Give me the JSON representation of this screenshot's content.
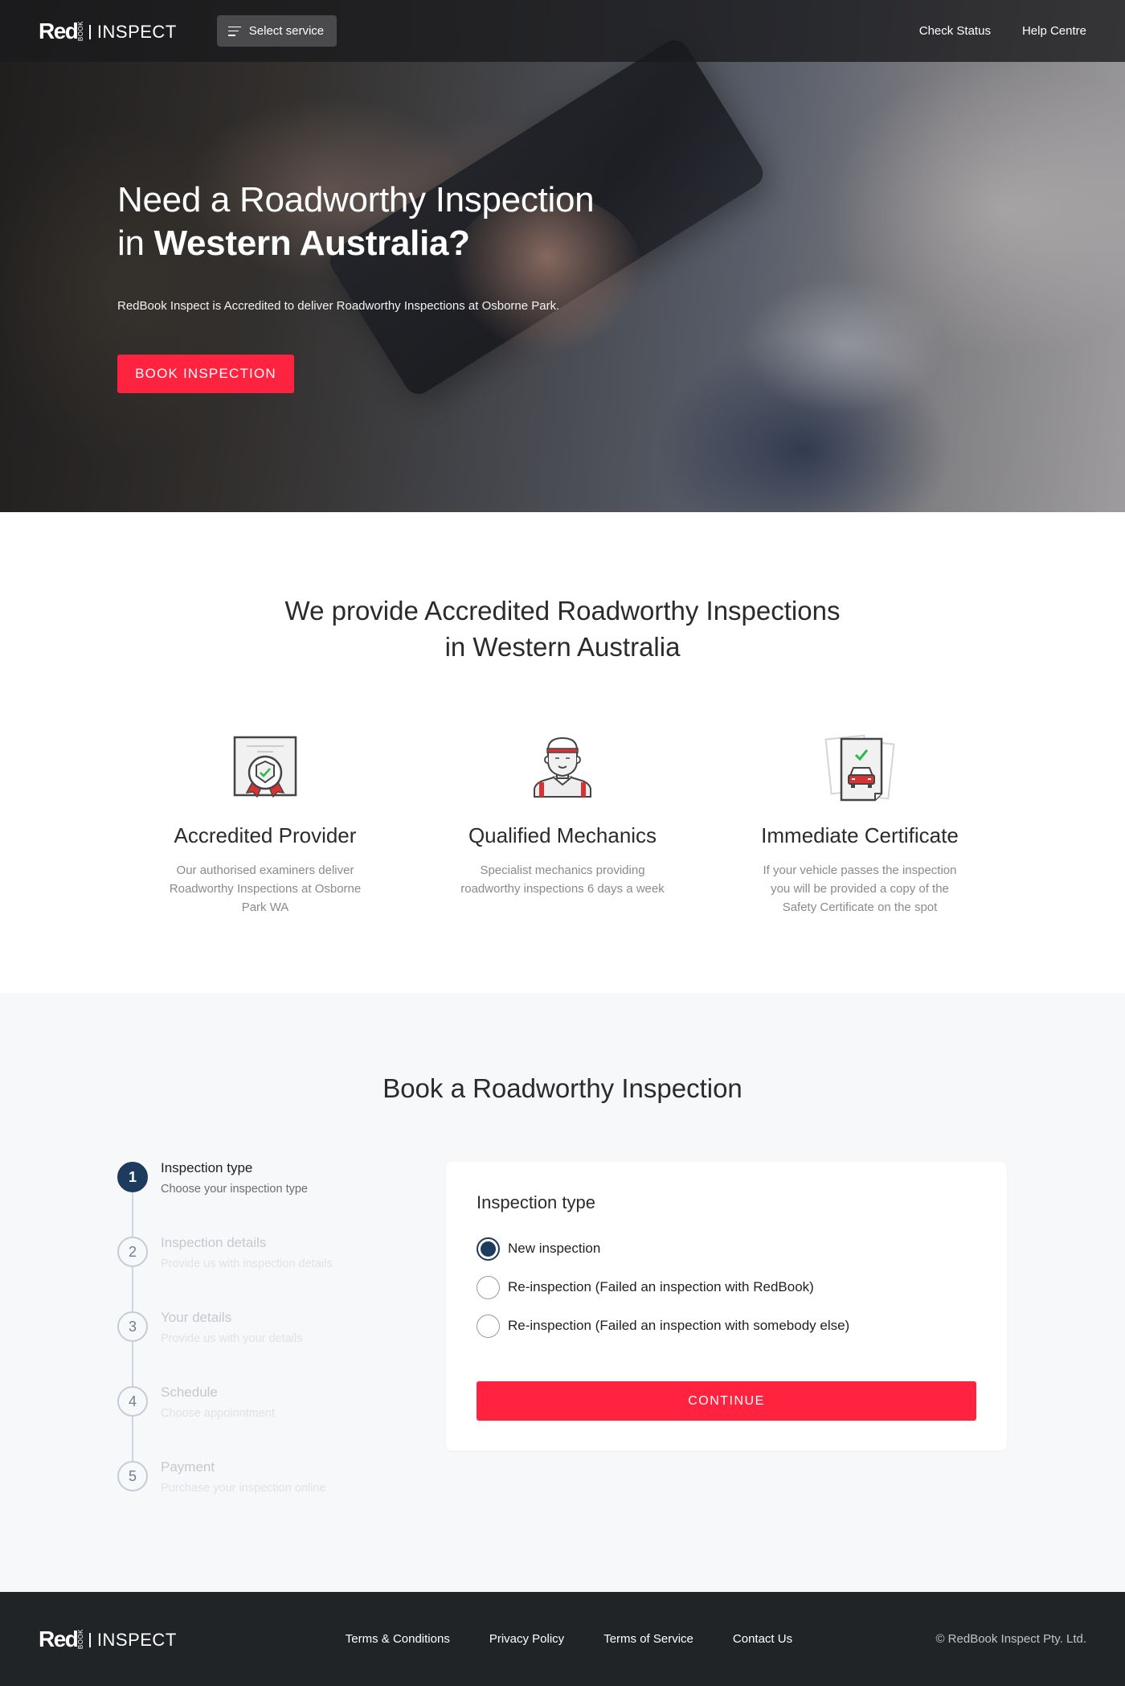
{
  "brand": {
    "logo_main": "Red",
    "logo_vertical": "BOOK",
    "logo_product": "INSPECT"
  },
  "nav": {
    "service_button": "Select service",
    "service_icon": "menu-icon",
    "links": [
      "Check Status",
      "Help Centre"
    ]
  },
  "hero": {
    "title_line1": "Need a Roadworthy Inspection",
    "title_line2_prefix": "in ",
    "title_line2_bold": "Western Australia?",
    "subtitle": "RedBook Inspect is Accredited to deliver Roadworthy Inspections at Osborne Park.",
    "cta": "BOOK INSPECTION"
  },
  "features": {
    "title_line1": "We provide Accredited Roadworthy Inspections",
    "title_line2": "in Western Australia",
    "items": [
      {
        "icon": "certificate-badge-icon",
        "title": "Accredited Provider",
        "description": "Our authorised examiners deliver Roadworthy Inspections at Osborne Park WA"
      },
      {
        "icon": "mechanic-icon",
        "title": "Qualified Mechanics",
        "description": "Specialist mechanics providing roadworthy inspections 6 days a week"
      },
      {
        "icon": "car-certificate-icon",
        "title": "Immediate Certificate",
        "description": "If your vehicle passes the inspection you will be provided a copy of the Safety Certificate on the spot"
      }
    ]
  },
  "booking": {
    "title": "Book a Roadworthy Inspection",
    "current_step": 1,
    "steps": [
      {
        "number": "1",
        "title": "Inspection type",
        "subtitle": "Choose your inspection type"
      },
      {
        "number": "2",
        "title": "Inspection details",
        "subtitle": "Provide us with inspection details"
      },
      {
        "number": "3",
        "title": "Your details",
        "subtitle": "Provide us with your details"
      },
      {
        "number": "4",
        "title": "Schedule",
        "subtitle": "Choose appoinntment"
      },
      {
        "number": "5",
        "title": "Payment",
        "subtitle": "Purchase your inspection online"
      }
    ],
    "card": {
      "title": "Inspection type",
      "options": [
        {
          "label": "New inspection",
          "selected": true
        },
        {
          "label": "Re-inspection (Failed an inspection with RedBook)",
          "selected": false
        },
        {
          "label": "Re-inspection (Failed an inspection with somebody else)",
          "selected": false
        }
      ],
      "continue": "CONTINUE"
    }
  },
  "footer": {
    "links": [
      "Terms & Conditions",
      "Privacy Policy",
      "Terms of Service",
      "Contact Us"
    ],
    "copyright": "© RedBook Inspect Pty. Ltd."
  },
  "colors": {
    "accent": "#ff2340",
    "primary_navy": "#1d3a5f",
    "footer_bg": "#212427",
    "section_bg": "#f7f8fa",
    "check_green": "#2db84d"
  }
}
